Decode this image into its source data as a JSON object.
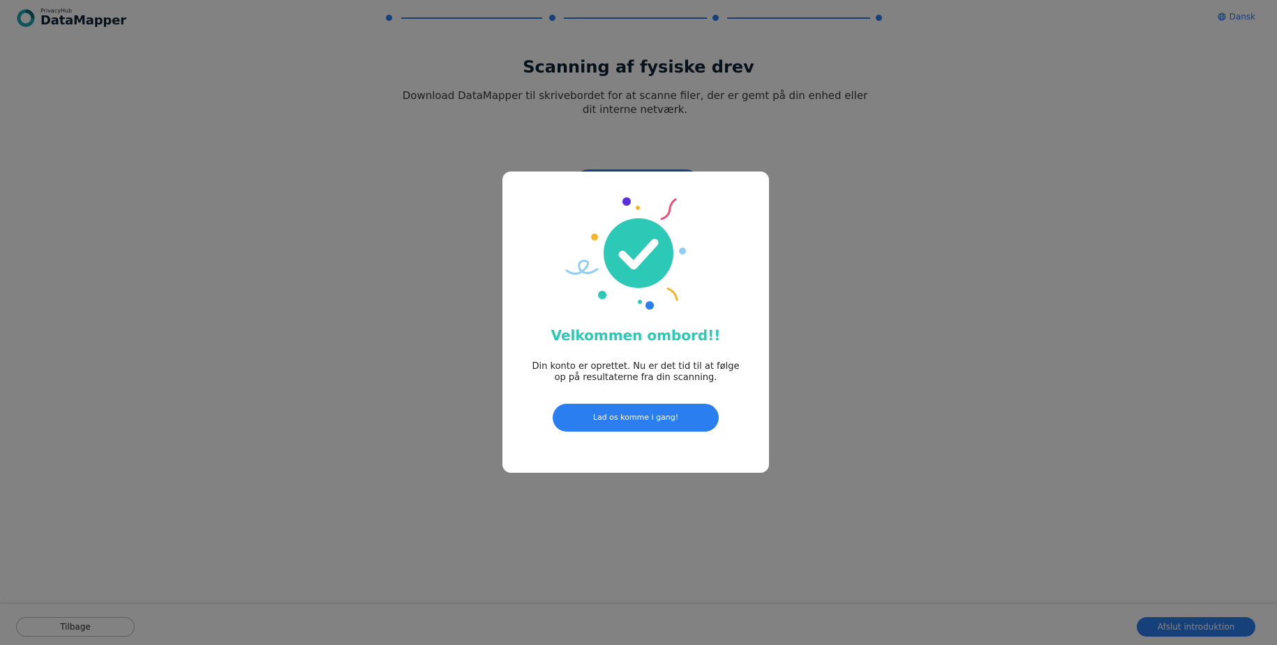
{
  "header": {
    "logo_small": "PrivacyHub",
    "logo_big": "DataMapper",
    "language": "Dansk",
    "step_count": 4
  },
  "main": {
    "title": "Scanning af fysiske drev",
    "description": "Download DataMapper til skrivebordet for at scanne filer, der er gemt på din enhed eller dit interne netværk."
  },
  "footer": {
    "back_label": "Tilbage",
    "finish_label": "Afslut introduktion"
  },
  "modal": {
    "title": "Velkommen ombord!!",
    "text": "Din konto er oprettet. Nu er det tid til at følge op på resultaterne fra din scanning.",
    "button_label": "Lad os komme i gang!"
  },
  "colors": {
    "accent": "#2a7ef0",
    "success": "#2ccab6",
    "overlay": "rgba(0,0,0,0.49)"
  },
  "icons": {
    "logo": "datamapper-ring-icon",
    "language": "globe-icon",
    "success": "checkmark-celebration-icon"
  }
}
